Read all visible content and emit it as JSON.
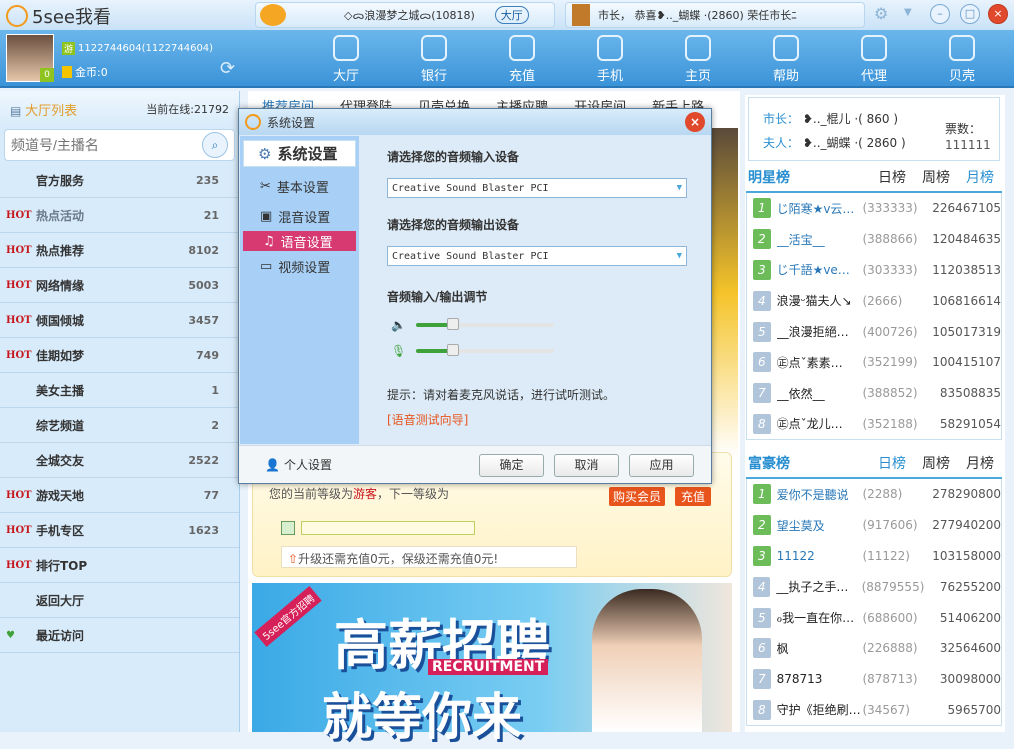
{
  "app": {
    "title": "5see我看"
  },
  "ticker1": {
    "text": "◇ᯅ浪漫梦之城ᯅ(10818)",
    "hall_btn": "大厅"
  },
  "ticker2": {
    "text": "市长， 恭喜❥.._蝴蝶 ·(2860) 荣任市长ﾆ"
  },
  "user": {
    "id": "1122744604(1122744604)",
    "guest_tag": "游",
    "gold": "金币:0",
    "level": "0"
  },
  "nav": [
    {
      "label": "大厅",
      "icon": "tv-icon"
    },
    {
      "label": "银行",
      "icon": "bank-icon"
    },
    {
      "label": "充值",
      "icon": "diamond-icon"
    },
    {
      "label": "手机",
      "icon": "phone-icon"
    },
    {
      "label": "主页",
      "icon": "home-icon"
    },
    {
      "label": "帮助",
      "icon": "help-icon"
    },
    {
      "label": "代理",
      "icon": "agent-icon"
    },
    {
      "label": "贝壳",
      "icon": "shell-icon"
    }
  ],
  "sidebar": {
    "title": "大厅列表",
    "online": "当前在线:21792",
    "search_placeholder": "频道号/主播名",
    "hot_label": "HOT",
    "items": [
      {
        "name": "官方服务",
        "count": "235",
        "hot": false
      },
      {
        "name": "热点活动",
        "count": "21",
        "hot": true
      },
      {
        "name": "热点推荐",
        "count": "8102",
        "hot": true
      },
      {
        "name": "网络情缘",
        "count": "5003",
        "hot": true
      },
      {
        "name": "倾国倾城",
        "count": "3457",
        "hot": true
      },
      {
        "name": "佳期如梦",
        "count": "749",
        "hot": true
      },
      {
        "name": "美女主播",
        "count": "1",
        "hot": false
      },
      {
        "name": "综艺频道",
        "count": "2",
        "hot": false
      },
      {
        "name": "全城交友",
        "count": "2522",
        "hot": false
      },
      {
        "name": "游戏天地",
        "count": "77",
        "hot": true
      },
      {
        "name": "手机专区",
        "count": "1623",
        "hot": true
      },
      {
        "name": "排行TOP",
        "count": "",
        "hot": true
      },
      {
        "name": "返回大厅",
        "count": "",
        "hot": false
      },
      {
        "name": "最近访问",
        "count": "",
        "hot": false
      }
    ]
  },
  "main": {
    "tabs": [
      "推荐房间",
      "代理登陆",
      "贝壳兑换",
      "主播应聘",
      "开设房间",
      "新手上路"
    ],
    "level_text": "您的当前等级为",
    "level_name": "游客",
    "level_next": "，下一等级为",
    "buy_vip": "购买会员",
    "recharge": "充值",
    "upgrade_tip": "升级还需充值0元，保级还需充值0元!",
    "banner": {
      "tag": "5see官方招聘",
      "line1": "高薪招聘",
      "en": "RECRUITMENT",
      "line2": "就等你来"
    }
  },
  "mayor": {
    "mayor_label": "市长：",
    "mayor_name": "❥.._棍儿 ·( 860 )",
    "wife_label": "夫人：",
    "wife_name": "❥.._蝴蝶 ·( 2860 )",
    "votes_label": "票数：",
    "votes": "111111"
  },
  "star_rank": {
    "title": "明星榜",
    "tabs": [
      "日榜",
      "周榜",
      "月榜"
    ],
    "active": "月榜",
    "rows": [
      [
        "1",
        "じ陌寒★v云…",
        "(333333)",
        "226467105"
      ],
      [
        "2",
        "__活宝__",
        "(388866)",
        "120484635"
      ],
      [
        "3",
        "じ千語★ve…",
        "(303333)",
        "112038513"
      ],
      [
        "4",
        "浪漫ᵕ猫夫人↘",
        "(2666)",
        "106816614"
      ],
      [
        "5",
        "__浪漫拒絕…",
        "(400726)",
        "105017319"
      ],
      [
        "6",
        "㊣点ˇ素素…",
        "(352199)",
        "100415107"
      ],
      [
        "7",
        "__依然__",
        "(388852)",
        "83508835"
      ],
      [
        "8",
        "㊣点ˇ龙儿…",
        "(352188)",
        "58291054"
      ]
    ]
  },
  "rich_rank": {
    "title": "富豪榜",
    "tabs": [
      "日榜",
      "周榜",
      "月榜"
    ],
    "active": "日榜",
    "rows": [
      [
        "1",
        "爱你不是聽说",
        "(2288)",
        "278290800"
      ],
      [
        "2",
        "望尘莫及",
        "(917606)",
        "277940200"
      ],
      [
        "3",
        "11122",
        "(11122)",
        "103158000"
      ],
      [
        "4",
        "__执子之手…",
        "(8879555)",
        "76255200"
      ],
      [
        "5",
        "ℴ我一直在你…",
        "(688600)",
        "51406200"
      ],
      [
        "6",
        "枫",
        "(226888)",
        "32564600"
      ],
      [
        "7",
        "878713",
        "(878713)",
        "30098000"
      ],
      [
        "8",
        "守护《拒绝刷…",
        "(34567)",
        "5965700"
      ]
    ]
  },
  "dialog": {
    "title": "系统设置",
    "nav_head": "系统设置",
    "nav": [
      "基本设置",
      "混音设置",
      "语音设置",
      "视频设置"
    ],
    "selected": "语音设置",
    "input_label": "请选择您的音频输入设备",
    "input_value": "Creative Sound Blaster PCI",
    "output_label": "请选择您的音频输出设备",
    "output_value": "Creative Sound Blaster PCI",
    "adjust_label": "音频输入/输出调节",
    "speaker_level": 0.27,
    "mic_level": 0.27,
    "tip": "提示：请对着麦克风说话，进行试听测试。",
    "wizard_link": "[语音测试向导]",
    "personal": "个人设置",
    "ok": "确定",
    "cancel": "取消",
    "apply": "应用"
  },
  "colors": {
    "accent": "#2a8fd0",
    "selected": "#d63a70",
    "hot": "#c8161d",
    "rank_top": "#6cbd5a",
    "rank_rest": "#b0c4da"
  }
}
